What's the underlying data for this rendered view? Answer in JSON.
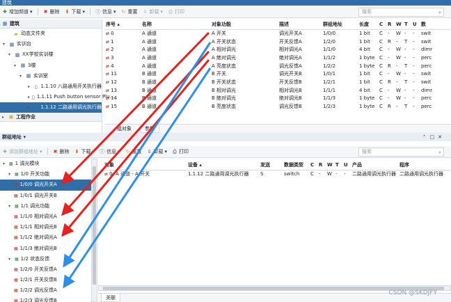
{
  "top": {
    "title": "建筑",
    "toolbar": {
      "add": "增加频道",
      "delete": "删除",
      "download": "下载",
      "info": "信息",
      "reset": "重置",
      "unload": "卸载",
      "print": "打印"
    },
    "search_placeholder": "搜索",
    "tree_header": "建筑",
    "tree": [
      {
        "label": "动态文件夹",
        "icon": "folder-icon"
      },
      {
        "label": "实训台",
        "icon": "building-icon"
      },
      {
        "label": "XX学校实训楼",
        "icon": "building-icon"
      },
      {
        "label": "3楼",
        "icon": "floor-icon"
      },
      {
        "label": "实训室",
        "icon": "room-icon"
      },
      {
        "label": "1.1.10 八路通用开关执行器",
        "icon": "device-icon"
      },
      {
        "label": "1.1.11 Push button sensor Plu...",
        "icon": "device-icon"
      },
      {
        "label": "1.1.12 二路通用调光执行器",
        "icon": "device-icon",
        "selected": true
      }
    ],
    "tree_footer": "工程作业",
    "columns": [
      "序号 ▴",
      "名称",
      "对象功能",
      "描述",
      "群组地址",
      "长度",
      "C",
      "R",
      "W",
      "T",
      "U",
      "数"
    ],
    "rows": [
      [
        "0",
        "A 通道",
        "A 开关",
        "调光开关A",
        "1/0/0",
        "1 bit",
        "C",
        "-",
        "W",
        "-",
        "-",
        "swit"
      ],
      [
        "1",
        "A 通道",
        "A 开关状态",
        "开关反馈A",
        "1/2/0",
        "1 bit",
        "C",
        "R",
        "-",
        "T",
        "-",
        "swit"
      ],
      [
        "2",
        "A 通道",
        "A 相对调光",
        "相对调光A",
        "1/1/0",
        "4 bit",
        "C",
        "-",
        "W",
        "-",
        "-",
        "dimr"
      ],
      [
        "3",
        "A 通道",
        "A 绝对调光",
        "绝对调光A",
        "1/1/2",
        "1 byte",
        "C",
        "-",
        "W",
        "-",
        "-",
        "perc"
      ],
      [
        "4",
        "A 通道",
        "A 亮度状态",
        "调光反馈A",
        "1/2/2",
        "1 byte",
        "C",
        "R",
        "-",
        "T",
        "-",
        "perc"
      ],
      [
        "11",
        "B 通道",
        "B 开关",
        "调光开关B",
        "1/0/1",
        "1 bit",
        "C",
        "-",
        "W",
        "-",
        "-",
        "swit"
      ],
      [
        "12",
        "B 通道",
        "B 开关状态",
        "开关反馈B",
        "1/2/1",
        "1 bit",
        "C",
        "R",
        "-",
        "T",
        "-",
        "swit"
      ],
      [
        "13",
        "B 通道",
        "B 相对调光",
        "相对调光B",
        "1/1/1",
        "4 bit",
        "C",
        "-",
        "W",
        "-",
        "-",
        "dimr"
      ],
      [
        "14",
        "B 通道",
        "B 绝对调光",
        "绝对调光B",
        "1/1/3",
        "1 byte",
        "C",
        "-",
        "W",
        "-",
        "-",
        "perc"
      ],
      [
        "15",
        "B 通道",
        "B 亮度状态",
        "调光反馈B",
        "1/2/3",
        "1 byte",
        "C",
        "R",
        "-",
        "T",
        "-",
        "perc"
      ]
    ],
    "tabs": [
      "组对象",
      "参数"
    ]
  },
  "bottom": {
    "title": "群组地址",
    "toolbar": {
      "add": "添加群组地址",
      "delete": "删除",
      "download": "下载",
      "info": "信息",
      "reset": "重置",
      "unload": "卸载",
      "print": "打印"
    },
    "search_placeholder": "搜索",
    "tree": [
      {
        "label": "1 调光模块",
        "level": 0
      },
      {
        "label": "1/0 开关功能",
        "level": 1
      },
      {
        "label": "1/0/0 调光开关A",
        "level": 2,
        "selected": true
      },
      {
        "label": "1/0/1 调光开关B",
        "level": 2
      },
      {
        "label": "1/1 调光功能",
        "level": 1
      },
      {
        "label": "1/1/0 相对调光A",
        "level": 2
      },
      {
        "label": "1/1/1 相对调光B",
        "level": 2
      },
      {
        "label": "1/1/2 绝对调光A",
        "level": 2
      },
      {
        "label": "1/1/3 绝对调光B",
        "level": 2
      },
      {
        "label": "1/2 状态反馈",
        "level": 1
      },
      {
        "label": "1/2/0 开关反馈A",
        "level": 2
      },
      {
        "label": "1/2/1 开关反馈B",
        "level": 2
      },
      {
        "label": "1/2/2 调光反馈A",
        "level": 2
      },
      {
        "label": "1/2/3 调光反馈B",
        "level": 2
      }
    ],
    "columns": [
      "对象",
      "设备 ▴",
      "发送",
      "数据类型",
      "C",
      "R",
      "W",
      "T",
      "U",
      "产品",
      "程序"
    ],
    "row": [
      "0: A 通道 - A 开关",
      "1.1.12 二路通用调光执行器",
      "S",
      "switch",
      "C",
      "-",
      "W",
      "-",
      "-",
      "二路通用调光执行器",
      "二路通用调光执行器"
    ],
    "tab": "关联"
  },
  "watermark": "CSDN @SKDJFY",
  "colors": {
    "accent": "#2f6ea8",
    "arrow_red": "#e5221c",
    "arrow_blue": "#2d8fe6"
  }
}
